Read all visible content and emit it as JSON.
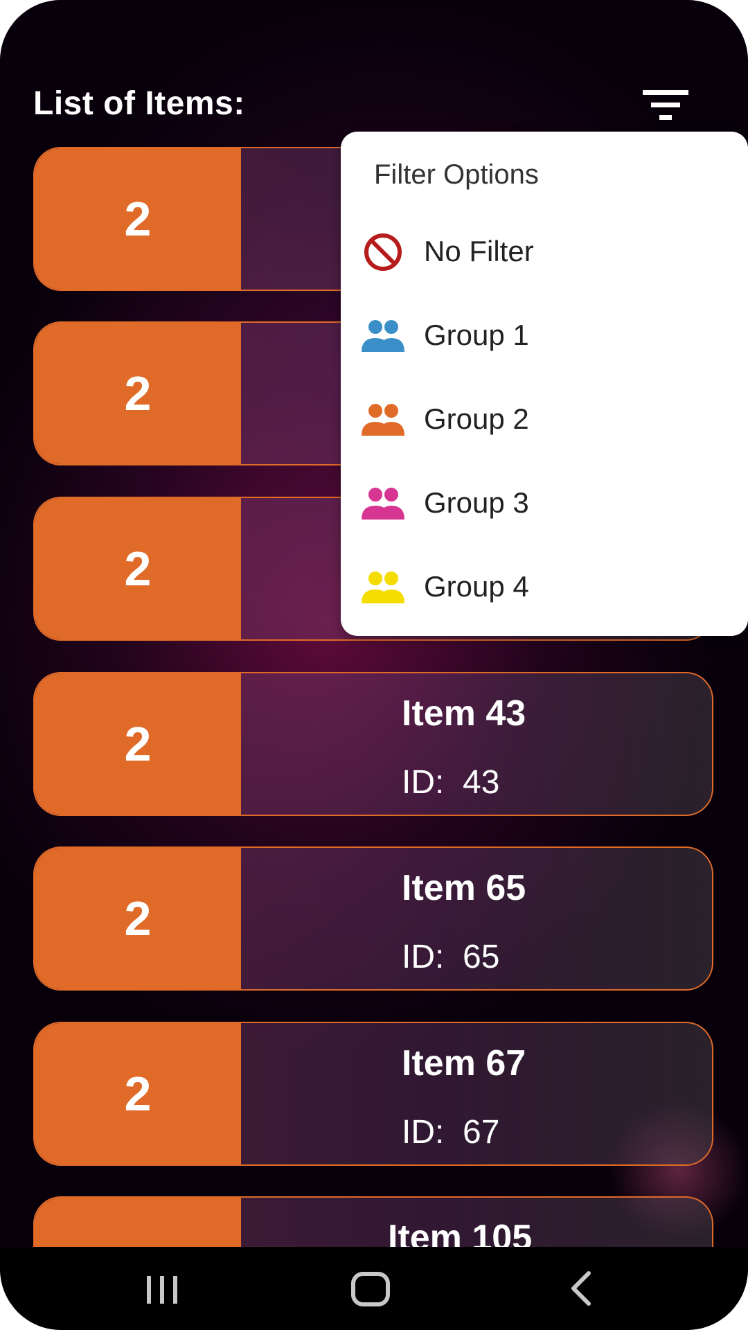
{
  "header": {
    "title": "List of Items:"
  },
  "icons": {
    "filter": "filter-list-icon"
  },
  "items": [
    {
      "badge": "2",
      "name": "",
      "id_label": "",
      "id": ""
    },
    {
      "badge": "2",
      "name": "",
      "id_label": "",
      "id": ""
    },
    {
      "badge": "2",
      "name": "",
      "id_label": "",
      "id": ""
    },
    {
      "badge": "2",
      "name": "Item 43",
      "id_label": "ID:",
      "id": "43"
    },
    {
      "badge": "2",
      "name": "Item 65",
      "id_label": "ID:",
      "id": "65"
    },
    {
      "badge": "2",
      "name": "Item 67",
      "id_label": "ID:",
      "id": "67"
    },
    {
      "badge": "",
      "name": "Item 105",
      "id_label": "",
      "id": ""
    }
  ],
  "filter_menu": {
    "header": "Filter Options",
    "options": [
      {
        "label": "No Filter",
        "icon": "block-icon",
        "color": "#b71c1c"
      },
      {
        "label": "Group 1",
        "icon": "group-icon",
        "color": "#3a8fc8"
      },
      {
        "label": "Group 2",
        "icon": "group-icon",
        "color": "#e06a28"
      },
      {
        "label": "Group 3",
        "icon": "group-icon",
        "color": "#d63592"
      },
      {
        "label": "Group 4",
        "icon": "group-icon",
        "color": "#f5dc00"
      }
    ]
  },
  "colors": {
    "accent": "#e06a28",
    "background": "#07000a"
  },
  "navbar": {
    "buttons": [
      "recent-apps",
      "home",
      "back"
    ]
  }
}
